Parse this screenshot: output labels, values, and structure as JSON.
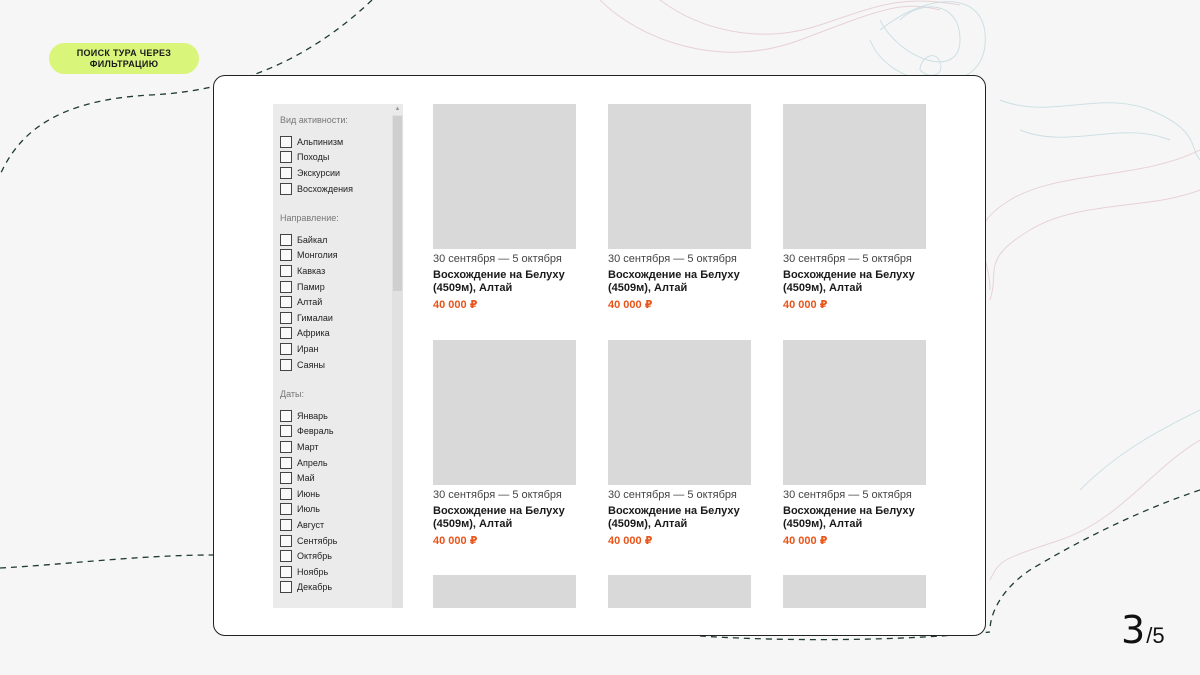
{
  "header": {
    "tag_label": "Поиск тура через фильтрацию"
  },
  "filters": {
    "activity": {
      "title": "Вид активности:",
      "options": [
        "Альпинизм",
        "Походы",
        "Экскурсии",
        "Восхождения"
      ]
    },
    "direction": {
      "title": "Направление:",
      "options": [
        "Байкал",
        "Монголия",
        "Кавказ",
        "Памир",
        "Алтай",
        "Гималаи",
        "Африка",
        "Иран",
        "Саяны"
      ]
    },
    "dates": {
      "title": "Даты:",
      "options": [
        "Январь",
        "Февраль",
        "Март",
        "Апрель",
        "Май",
        "Июнь",
        "Июль",
        "Август",
        "Сентябрь",
        "Октябрь",
        "Ноябрь",
        "Декабрь"
      ]
    }
  },
  "tours": [
    {
      "dates": "30 сентября — 5 октября",
      "title": "Восхождение на Белуху (4509м), Алтай",
      "price": "40 000 ₽"
    },
    {
      "dates": "30 сентября — 5 октября",
      "title": "Восхождение на Белуху (4509м), Алтай",
      "price": "40 000 ₽"
    },
    {
      "dates": "30 сентября — 5 октября",
      "title": "Восхождение на Белуху (4509м), Алтай",
      "price": "40 000 ₽"
    },
    {
      "dates": "30 сентября — 5 октября",
      "title": "Восхождение на Белуху (4509м), Алтай",
      "price": "40 000 ₽"
    },
    {
      "dates": "30 сентября — 5 октября",
      "title": "Восхождение на Белуху (4509м), Алтай",
      "price": "40 000 ₽"
    },
    {
      "dates": "30 сентября — 5 октября",
      "title": "Восхождение на Белуху (4509м), Алтай",
      "price": "40 000 ₽"
    }
  ],
  "pager": {
    "current": "3",
    "separator": "/",
    "total": "5"
  },
  "colors": {
    "accent_tag": "#d9f57a",
    "price": "#e8541a",
    "placeholder": "#d9d9d9"
  }
}
